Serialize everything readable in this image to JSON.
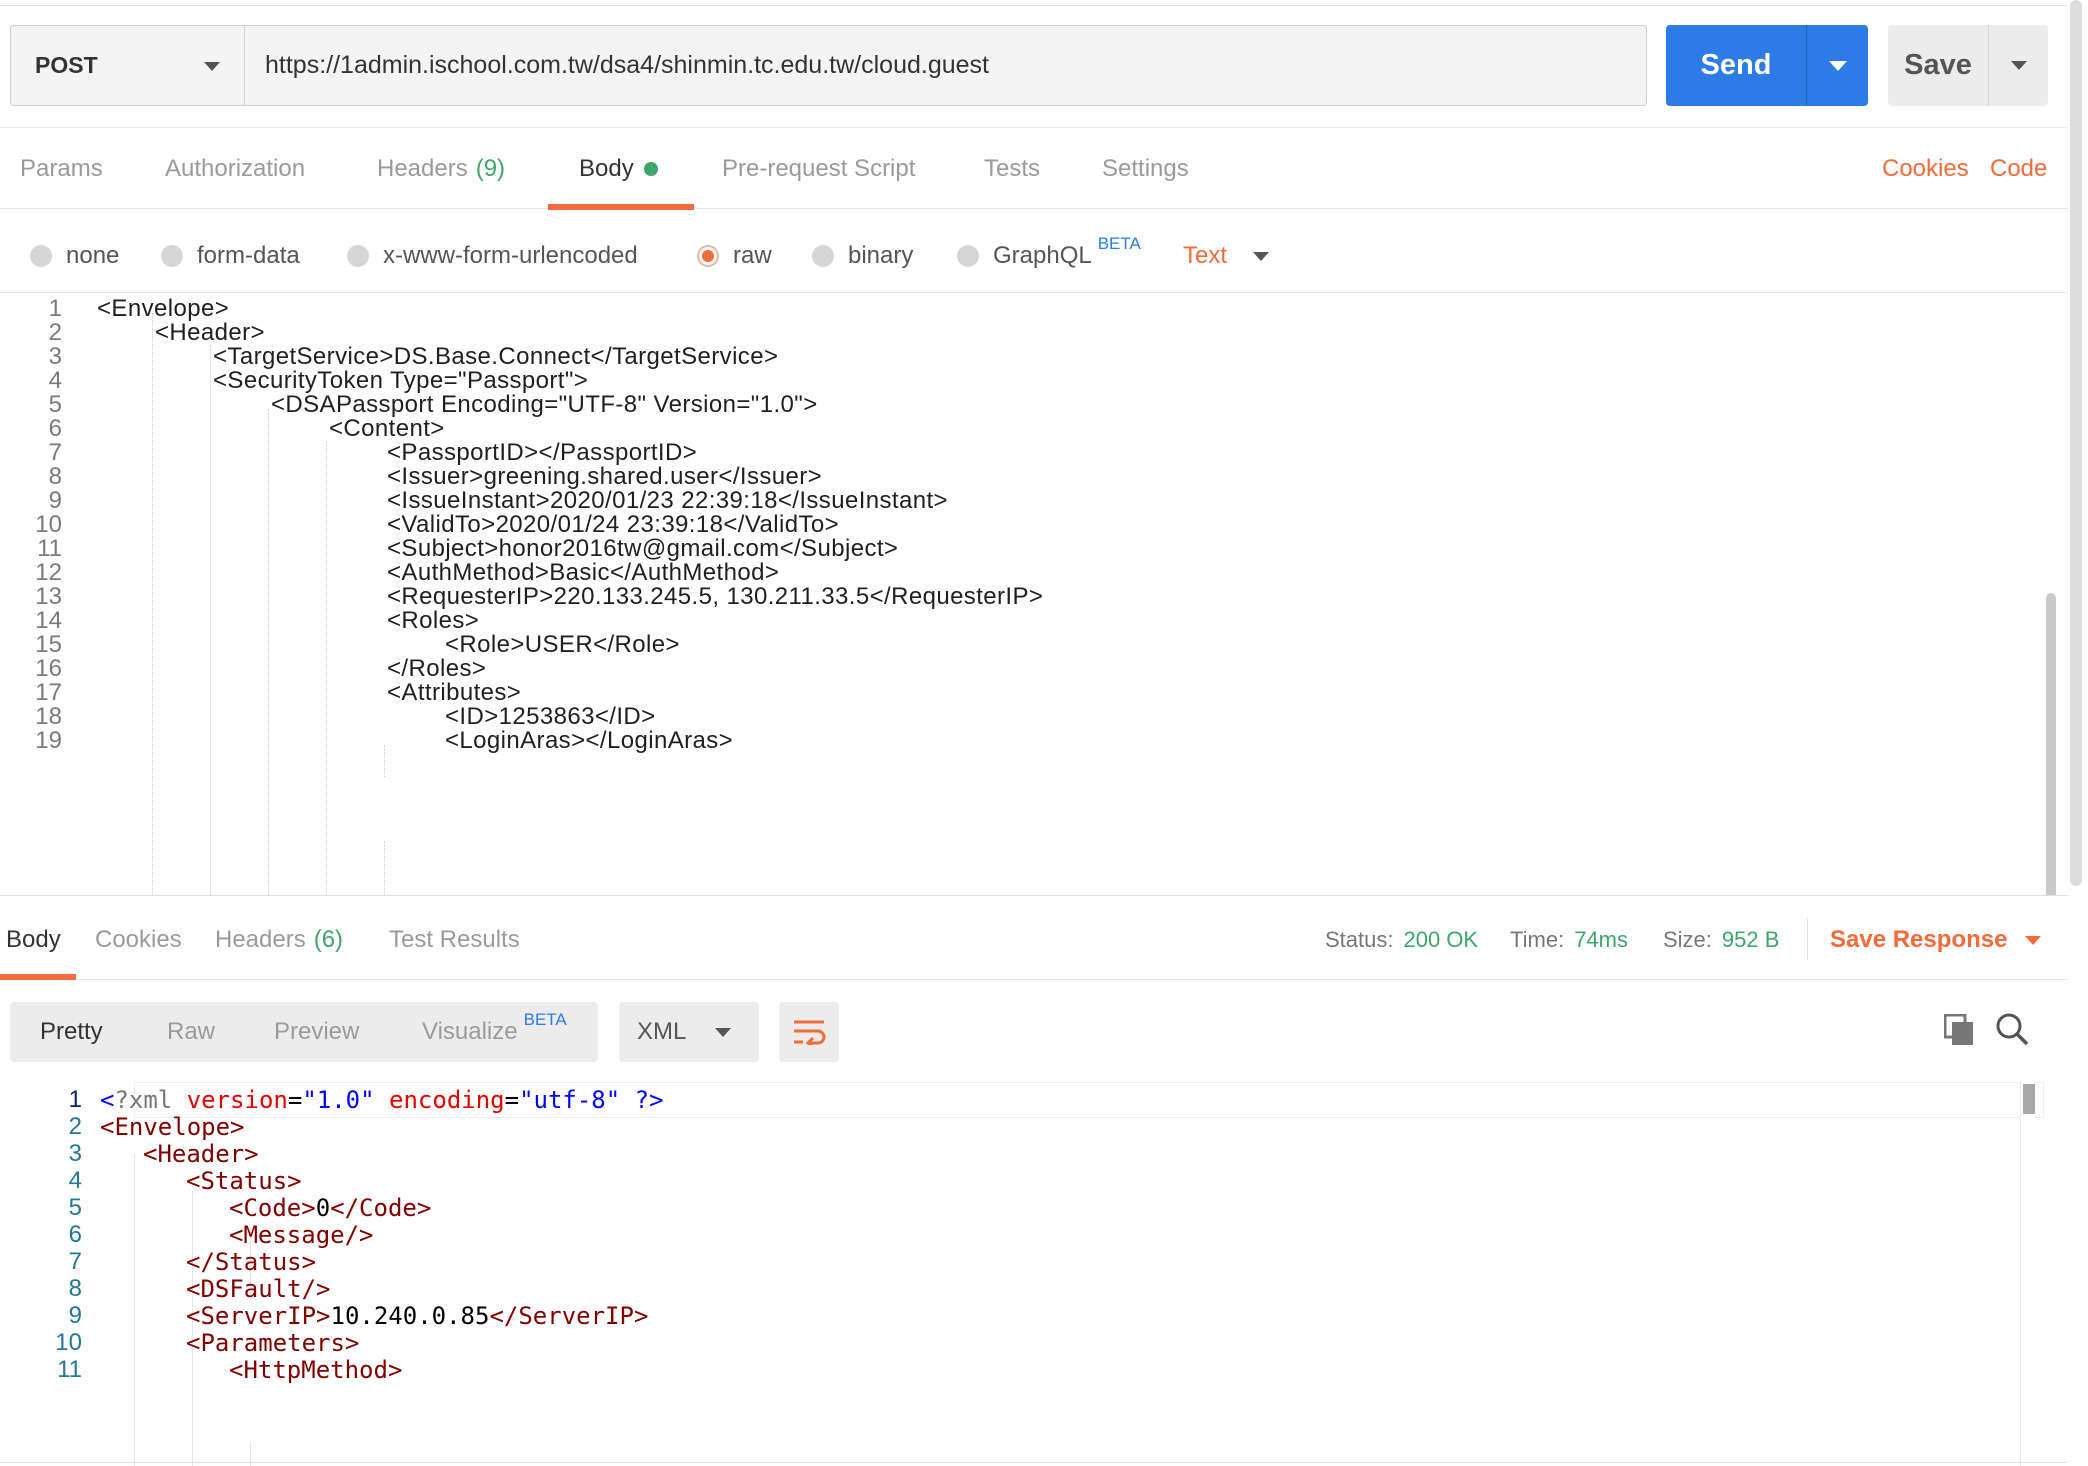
{
  "request": {
    "method": "POST",
    "url": "https://1admin.ischool.com.tw/dsa4/shinmin.tc.edu.tw/cloud.guest",
    "send_label": "Send",
    "save_label": "Save"
  },
  "request_tabs": [
    {
      "label": "Params"
    },
    {
      "label": "Authorization"
    },
    {
      "label": "Headers",
      "count": "(9)"
    },
    {
      "label": "Body"
    },
    {
      "label": "Pre-request Script"
    },
    {
      "label": "Tests"
    },
    {
      "label": "Settings"
    }
  ],
  "request_links": {
    "cookies": "Cookies",
    "code": "Code"
  },
  "body_types": [
    {
      "label": "none"
    },
    {
      "label": "form-data"
    },
    {
      "label": "x-www-form-urlencoded"
    },
    {
      "label": "raw"
    },
    {
      "label": "binary"
    },
    {
      "label": "GraphQL",
      "badge": "BETA"
    }
  ],
  "body_format": "Text",
  "request_body_lines": [
    {
      "n": "1",
      "text": "<Envelope>"
    },
    {
      "n": "2",
      "text": "<Header>"
    },
    {
      "n": "3",
      "text": "<TargetService>DS.Base.Connect</TargetService>"
    },
    {
      "n": "4",
      "text": "<SecurityToken Type=\"Passport\">"
    },
    {
      "n": "5",
      "text": "<DSAPassport Encoding=\"UTF-8\" Version=\"1.0\">"
    },
    {
      "n": "6",
      "text": "<Content>"
    },
    {
      "n": "7",
      "text": "<PassportID></PassportID>"
    },
    {
      "n": "8",
      "text": "<Issuer>greening.shared.user</Issuer>"
    },
    {
      "n": "9",
      "text": "<IssueInstant>2020/01/23 22:39:18</IssueInstant>"
    },
    {
      "n": "10",
      "text": "<ValidTo>2020/01/24 23:39:18</ValidTo>"
    },
    {
      "n": "11",
      "text": "<Subject>honor2016tw@gmail.com</Subject>"
    },
    {
      "n": "12",
      "text": "<AuthMethod>Basic</AuthMethod>"
    },
    {
      "n": "13",
      "text": "<RequesterIP>220.133.245.5, 130.211.33.5</RequesterIP>"
    },
    {
      "n": "14",
      "text": "<Roles>"
    },
    {
      "n": "15",
      "text": "<Role>USER</Role>"
    },
    {
      "n": "16",
      "text": "</Roles>"
    },
    {
      "n": "17",
      "text": "<Attributes>"
    },
    {
      "n": "18",
      "text": "<ID>1253863</ID>"
    },
    {
      "n": "19",
      "text": "<LoginAras></LoginAras>"
    }
  ],
  "response_tabs": [
    {
      "label": "Body"
    },
    {
      "label": "Cookies"
    },
    {
      "label": "Headers",
      "count": "(6)"
    },
    {
      "label": "Test Results"
    }
  ],
  "response_meta": {
    "status_label": "Status:",
    "status_value": "200 OK",
    "time_label": "Time:",
    "time_value": "74ms",
    "size_label": "Size:",
    "size_value": "952 B",
    "save_response": "Save Response"
  },
  "view_modes": [
    {
      "label": "Pretty"
    },
    {
      "label": "Raw"
    },
    {
      "label": "Preview"
    },
    {
      "label": "Visualize",
      "badge": "BETA"
    }
  ],
  "response_format": "XML",
  "response_lines": [
    {
      "n": "1",
      "decl_open": "<",
      "decl_name": "?xml",
      "attr1": "version",
      "val1": "\"1.0\"",
      "attr2": "encoding",
      "val2": "\"utf-8\"",
      "decl_close": "?>"
    },
    {
      "n": "2",
      "open": "<Envelope>"
    },
    {
      "n": "3",
      "open": "<Header>"
    },
    {
      "n": "4",
      "open": "<Status>"
    },
    {
      "n": "5",
      "open": "<Code>",
      "text": "0",
      "close": "</Code>"
    },
    {
      "n": "6",
      "open": "<Message/>"
    },
    {
      "n": "7",
      "open": "</Status>"
    },
    {
      "n": "8",
      "open": "<DSFault/>"
    },
    {
      "n": "9",
      "open": "<ServerIP>",
      "text": "10.240.0.85",
      "close": "</ServerIP>"
    },
    {
      "n": "10",
      "open": "<Parameters>"
    },
    {
      "n": "11",
      "open": "<HttpMethod>"
    }
  ],
  "icons": {
    "method_dropdown": "chevron-down-icon",
    "send_dropdown": "chevron-down-icon",
    "save_dropdown": "chevron-down-icon",
    "wrap": "wrap-lines-icon",
    "copy": "copy-icon",
    "search": "search-icon"
  },
  "colors": {
    "accent": "#f26b3a",
    "send": "#2d7be5",
    "success": "#3ea66b",
    "xml_tag": "#800000",
    "xml_attr": "#e50000",
    "xml_value": "#0000ff"
  }
}
